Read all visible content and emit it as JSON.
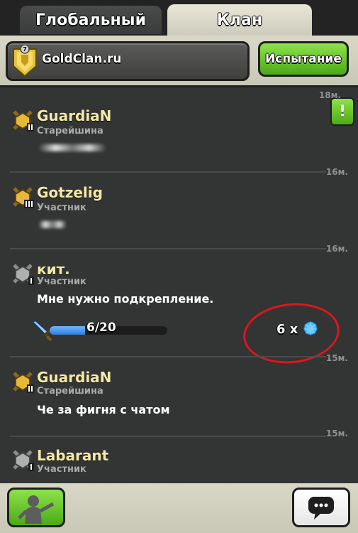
{
  "tabs": [
    {
      "label": "Глобальный",
      "active": false
    },
    {
      "label": "Клан",
      "active": true
    }
  ],
  "header": {
    "clan_name": "GoldClan.ru",
    "clan_level": "7",
    "challenge_label": "Испытание"
  },
  "alert_label": "!",
  "messages": [
    {
      "time": "18м.",
      "name": "GuardiaN",
      "role": "Старейшина",
      "text": ""
    },
    {
      "time": "16м.",
      "name": "Gotzelig",
      "role": "Участник",
      "text": ""
    },
    {
      "time": "16м.",
      "name": "кит.",
      "role": "Участник",
      "text": "Мне нужно подкрепление.",
      "request": {
        "progress_text": "6/20",
        "filled": 6,
        "total": 20,
        "reward": "6 x"
      }
    },
    {
      "time": "15м.",
      "name": "GuardiaN",
      "role": "Старейшина",
      "text": "Че за фигня с чатом"
    },
    {
      "time": "15м.",
      "name": "Labarant",
      "role": "Участник",
      "text": ""
    }
  ],
  "colors": {
    "name_gold": "#f4e9a6",
    "accent_green": "#6cc830",
    "annotation_red": "#e0151b"
  }
}
